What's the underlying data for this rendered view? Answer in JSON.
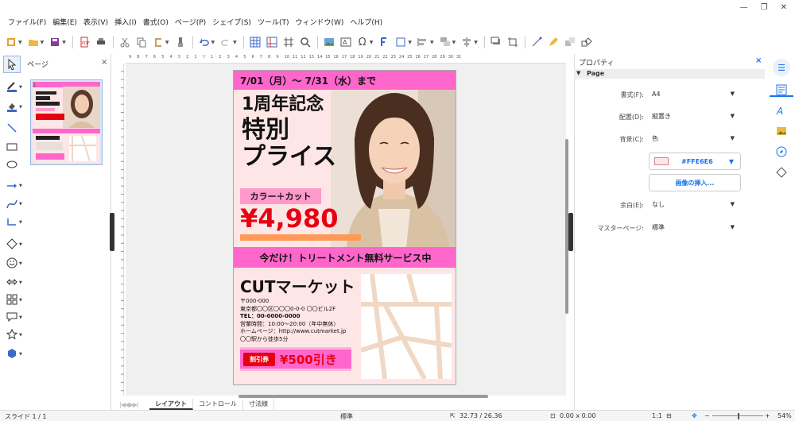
{
  "menu": [
    "ファイル(F)",
    "編集(E)",
    "表示(V)",
    "挿入(I)",
    "書式(O)",
    "ページ(P)",
    "シェイプ(S)",
    "ツール(T)",
    "ウィンドウ(W)",
    "ヘルプ(H)"
  ],
  "slide_pane": {
    "title": "ページ",
    "slide_number": "1"
  },
  "ruler": {
    "marks": [
      "9",
      "8",
      "7",
      "6",
      "5",
      "4",
      "3",
      "2",
      "1",
      "",
      "1",
      "2",
      "3",
      "4",
      "5",
      "6",
      "7",
      "8",
      "9",
      "10",
      "11",
      "12",
      "13",
      "14",
      "15",
      "16",
      "17",
      "18",
      "19",
      "20",
      "21",
      "22",
      "23",
      "24",
      "25",
      "26",
      "27",
      "28",
      "29",
      "30",
      "31"
    ]
  },
  "poster": {
    "date": "7/01（月）〜 7/31（水）まで",
    "title_lines": [
      "1周年記念",
      "特別",
      "プライス"
    ],
    "badge": "カラー＋カット",
    "price": "¥4,980",
    "promo": "今だけ！トリートメント無料サービス中",
    "shop_name": "CUTマーケット",
    "address_lines": [
      "〒000-000",
      "東京都〇〇区〇〇〇0-0-0 〇〇ビル2F",
      "TEL：00-0000-0000",
      "営業時間：10:00〜20:00（年中無休）",
      "ホームページ：http://www.cutmarket.jp",
      "〇〇駅から徒歩5分"
    ],
    "coupon_tag": "割引券",
    "coupon_value": "¥500引き"
  },
  "tabs": [
    "レイアウト",
    "コントロール",
    "寸法線"
  ],
  "properties": {
    "title": "プロパティ",
    "section": "Page",
    "format_label": "書式(F):",
    "format_value": "A4",
    "orientation_label": "配置(D):",
    "orientation_value": "縦置き",
    "background_label": "背景(C):",
    "background_value": "色",
    "color_value": "#FFE6E6",
    "insert_image": "画像の挿入...",
    "margin_label": "余白(E):",
    "margin_value": "なし",
    "master_label": "マスターページ:",
    "master_value": "標準"
  },
  "status": {
    "slide": "スライド 1 / 1",
    "master": "標準",
    "position": "32.73 / 26.36",
    "size": "0.00 x 0.00",
    "scale": "1:1",
    "zoom": "54%"
  },
  "colors": {
    "accent_pink": "#ff66cc",
    "price_red": "#e60012",
    "page_bg": "#ffe6e6",
    "link_blue": "#1a73e8"
  }
}
